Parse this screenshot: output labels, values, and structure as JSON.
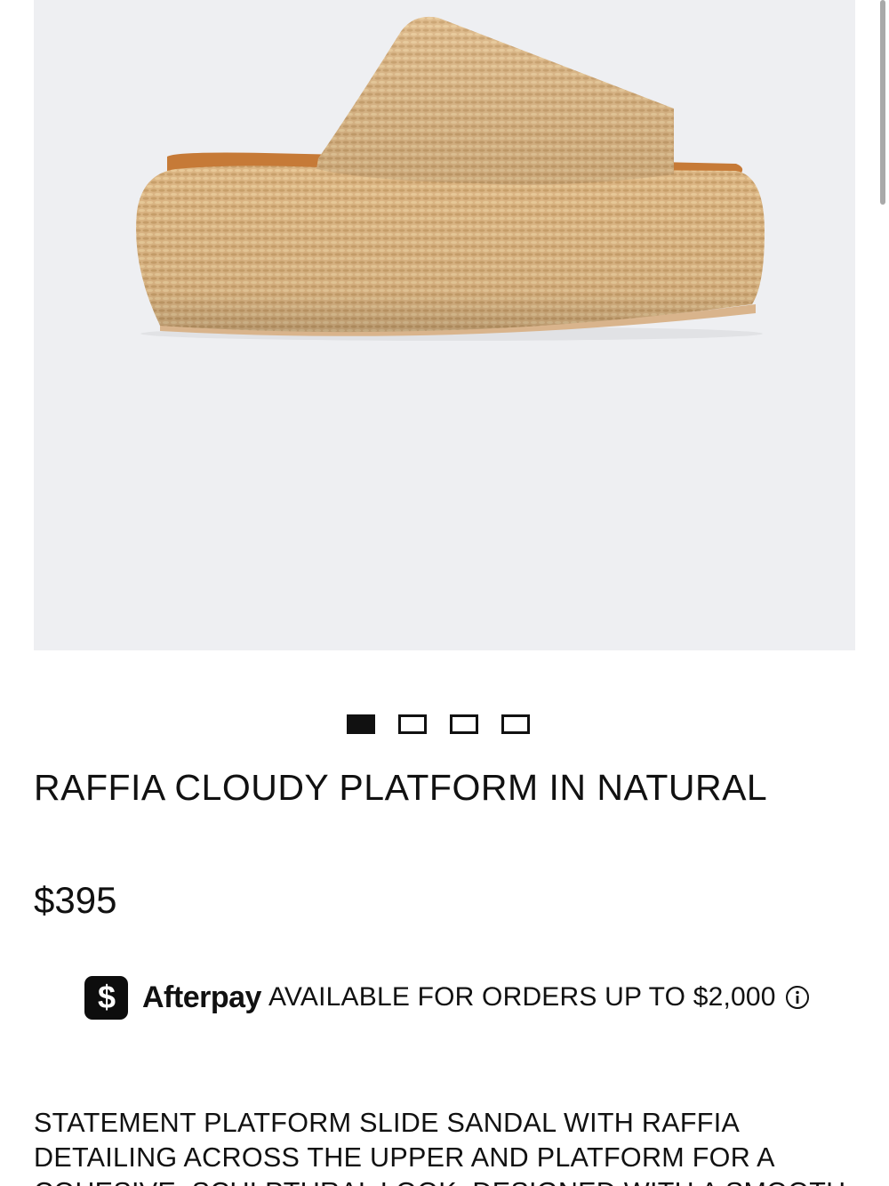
{
  "product": {
    "title": "RAFFIA CLOUDY PLATFORM IN NATURAL",
    "price": "$395",
    "description": "STATEMENT PLATFORM SLIDE SANDAL WITH RAFFIA DETAILING ACROSS THE UPPER AND PLATFORM FOR A COHESIVE, SCULPTURAL LOOK. DESIGNED WITH A SMOOTH VEGAN"
  },
  "gallery": {
    "image_count": 4,
    "active_index": 0,
    "image_subject": "raffia platform slide sandal, side view"
  },
  "afterpay": {
    "brand": "Afterpay",
    "cash_symbol": "$",
    "message": "AVAILABLE FOR ORDERS UP TO $2,000",
    "icon": "info-icon"
  },
  "colors": {
    "hero_background": "#eeeff2",
    "raffia": "#dcb684",
    "leather_trim": "#c67a37",
    "text": "#111111"
  }
}
